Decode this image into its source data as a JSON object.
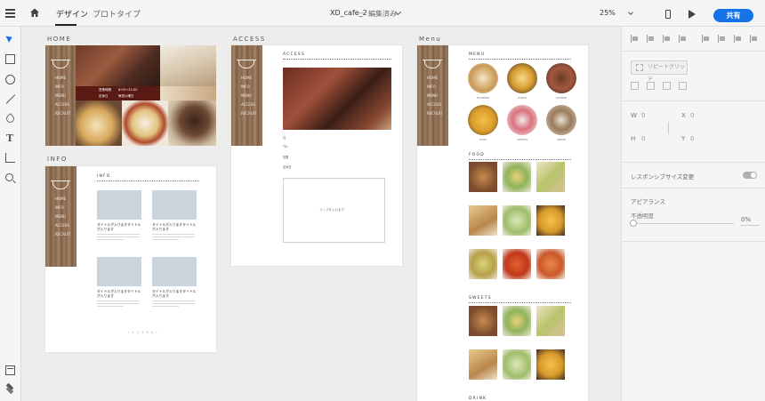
{
  "topbar": {
    "tabs": [
      {
        "label": "デザイン",
        "active": true
      },
      {
        "label": "プロトタイプ",
        "active": false
      }
    ],
    "doc_title": "XD_cafe_2",
    "doc_separator": "—",
    "doc_status": "編集済み",
    "zoom": "25%",
    "share_label": "共有",
    "accent_color": "#1473e6"
  },
  "toolbar": {
    "tools": [
      "select-tool",
      "rectangle-tool",
      "ellipse-tool",
      "line-tool",
      "pen-tool",
      "text-tool",
      "artboard-tool",
      "zoom-tool"
    ],
    "bottom_tools": [
      "assets-panel",
      "layers-panel"
    ]
  },
  "right_panel": {
    "repeat_grid_label": "リピートグリッド",
    "w_label": "W",
    "w_value": "0",
    "x_label": "X",
    "x_value": "0",
    "h_label": "H",
    "h_value": "0",
    "y_label": "Y",
    "y_value": "0",
    "responsive_label": "レスポンシブサイズ変更",
    "appearance_label": "アピアランス",
    "opacity_label": "不透明度",
    "opacity_value": "0%"
  },
  "artboards": {
    "home": {
      "label": "HOME",
      "nav": [
        "HOME",
        "INFO",
        "MENU",
        "ACCESS",
        "RECRUIT"
      ],
      "hours_label": "営業時間",
      "hours_value": "8:00～21:00",
      "holiday_label": "定休日",
      "holiday_value": "毎週火曜日"
    },
    "info": {
      "label": "INFO",
      "nav": [
        "HOME",
        "INFO",
        "MENU",
        "ACCESS",
        "RECRUIT"
      ],
      "heading": "INFO",
      "post_title": "タイトルが入りますタイトルが入ります",
      "pagination": "‹  1 2 3 4 5  ›"
    },
    "access": {
      "label": "ACCESS",
      "nav": [
        "HOME",
        "INFO",
        "MENU",
        "ACCESS",
        "RECRUIT"
      ],
      "heading": "ACCESS",
      "rows": [
        "住",
        "TEL",
        "営業",
        "定休日"
      ],
      "map_text": "マップを入れます"
    },
    "menu": {
      "label": "Menu",
      "nav": [
        "HOME",
        "INFO",
        "MENU",
        "ACCESS",
        "RECRUIT"
      ],
      "heading": "MENU",
      "categories": [
        "MORNING",
        "LUNCH",
        "DINNER",
        "FOOD",
        "SWEETS",
        "DRINK"
      ],
      "food_heading": "FOOD",
      "sweets_heading": "SWEETS",
      "drink_heading": "DRINK"
    }
  }
}
